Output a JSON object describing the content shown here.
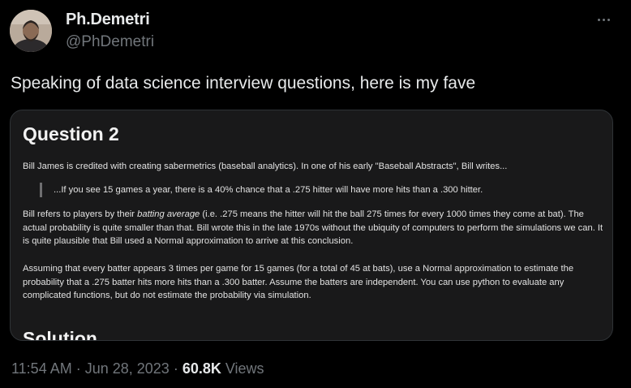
{
  "author": {
    "display_name": "Ph.Demetri",
    "handle": "@PhDemetri"
  },
  "tweet": {
    "text": "Speaking of data science interview questions, here is my fave"
  },
  "card": {
    "title": "Question 2",
    "paragraph1": "Bill James is credited with creating sabermetrics (baseball analytics). In one of his early \"Baseball Abstracts\", Bill writes...",
    "quote": "...If you see 15 games a year, there is a 40% chance that a .275 hitter will have more hits than a .300 hitter.",
    "paragraph2_before": "Bill refers to players by their ",
    "paragraph2_em": "batting average",
    "paragraph2_after": " (i.e. .275 means the hitter will hit the ball 275 times for every 1000 times they come at bat). The actual probability is quite smaller than that. Bill wrote this in the late 1970s without the ubiquity of computers to perform the simulations we can. It is quite plausible that Bill used a Normal approximation to arrive at this conclusion.",
    "paragraph3": "Assuming that every batter appears 3 times per game for 15 games (for a total of 45 at bats), use a Normal approximation to estimate the probability that a .275 batter hits more hits than a .300 batter. Assume the batters are independent. You can use python to evaluate any complicated functions, but do not estimate the probability via simulation.",
    "solution_heading": "Solution"
  },
  "meta": {
    "time": "11:54 AM",
    "separator1": " · ",
    "date": "Jun 28, 2023",
    "separator2": " · ",
    "views_count": "60.8K",
    "views_label": " Views"
  },
  "icons": {
    "more": "more-horizontal-icon",
    "avatar": "profile-photo"
  },
  "colors": {
    "background": "#000000",
    "primary_text": "#e7e9ea",
    "secondary_text": "#71767b",
    "card_background": "#19191a",
    "card_border": "#2f3336"
  }
}
